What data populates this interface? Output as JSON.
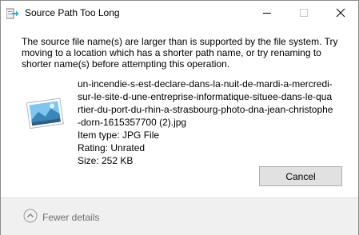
{
  "window": {
    "title": "Source Path Too Long"
  },
  "message": "The source file name(s) are larger than is supported by the file system. Try moving to a location which has a shorter path name, or try renaming to shorter name(s) before attempting this operation.",
  "file": {
    "name": "un-incendie-s-est-declare-dans-la-nuit-de-mardi-a-mercredi-sur-le-site-d-une-entreprise-informatique-situee-dans-le-quartier-du-port-du-rhin-a-strasbourg-photo-dna-jean-christophe-dorn-1615357700 (2).jpg",
    "type": "Item type: JPG File",
    "rating": "Rating: Unrated",
    "size": "Size: 252 KB"
  },
  "buttons": {
    "cancel": "Cancel",
    "fewer_details": "Fewer details"
  },
  "colors": {
    "footer_bg": "#f0f0f0",
    "button_bg": "#e1e1e1",
    "icon_accent": "#2aa8d8"
  }
}
